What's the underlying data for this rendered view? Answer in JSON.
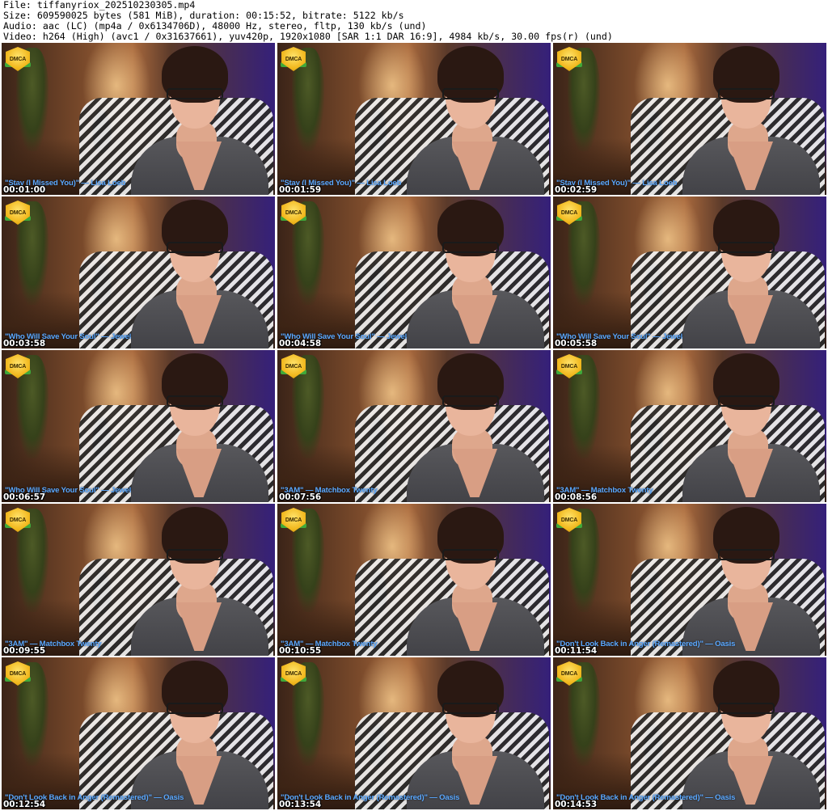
{
  "header": {
    "file_line": "File: tiffanyriox_202510230305.mp4",
    "size_line": "Size: 609590025 bytes (581 MiB), duration: 00:15:52, bitrate: 5122 kb/s",
    "audio_line": "Audio: aac (LC) (mp4a / 0x6134706D), 48000 Hz, stereo, fltp, 130 kb/s (und)",
    "video_line": "Video: h264 (High) (avc1 / 0x31637661), yuv420p, 1920x1080 [SAR 1:1 DAR 16:9], 4984 kb/s, 30.00 fps(r) (und)"
  },
  "badge_text": "DMCA",
  "colors": {
    "caption": "#5aa8ff",
    "timestamp": "#ffffff",
    "badge": "#f2b91f"
  },
  "thumbnails": [
    {
      "timestamp": "00:01:00",
      "caption": "\"Stay (I Missed You)\" — Lisa Loeb"
    },
    {
      "timestamp": "00:01:59",
      "caption": "\"Stay (I Missed You)\" — Lisa Loeb"
    },
    {
      "timestamp": "00:02:59",
      "caption": "\"Stay (I Missed You)\" — Lisa Loeb"
    },
    {
      "timestamp": "00:03:58",
      "caption": "\"Who Will Save Your Soul\" — Jewel"
    },
    {
      "timestamp": "00:04:58",
      "caption": "\"Who Will Save Your Soul\" — Jewel"
    },
    {
      "timestamp": "00:05:58",
      "caption": "\"Who Will Save Your Soul\" — Jewel"
    },
    {
      "timestamp": "00:06:57",
      "caption": "\"Who Will Save Your Soul\" — Jewel"
    },
    {
      "timestamp": "00:07:56",
      "caption": "\"3AM\" — Matchbox Twenty"
    },
    {
      "timestamp": "00:08:56",
      "caption": "\"3AM\" — Matchbox Twenty"
    },
    {
      "timestamp": "00:09:55",
      "caption": "\"3AM\" — Matchbox Twenty"
    },
    {
      "timestamp": "00:10:55",
      "caption": "\"3AM\" — Matchbox Twenty"
    },
    {
      "timestamp": "00:11:54",
      "caption": "\"Don't Look Back in Anger (Remastered)\" — Oasis"
    },
    {
      "timestamp": "00:12:54",
      "caption": "\"Don't Look Back in Anger (Remastered)\" — Oasis"
    },
    {
      "timestamp": "00:13:54",
      "caption": "\"Don't Look Back in Anger (Remastered)\" — Oasis"
    },
    {
      "timestamp": "00:14:53",
      "caption": "\"Don't Look Back in Anger (Remastered)\" — Oasis"
    }
  ]
}
